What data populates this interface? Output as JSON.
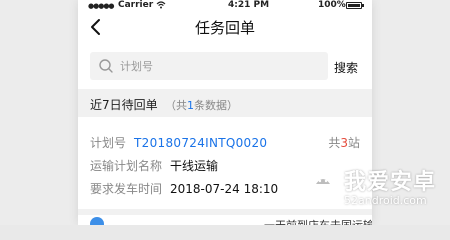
{
  "status_bar": {
    "signal": "●●●●●",
    "carrier": "Carrier",
    "time": "4:21 PM",
    "battery_pct": "100%"
  },
  "nav": {
    "title": "任务回单",
    "back_icon": "chevron-left-icon"
  },
  "search": {
    "placeholder": "计划号",
    "button_label": "搜索",
    "icon": "search-icon"
  },
  "section": {
    "title": "近7日待回单",
    "count_prefix": "（共",
    "count_value": "1",
    "count_suffix": "条数据）"
  },
  "card": {
    "plan_no_label": "计划号",
    "plan_no_value": "T20180724INTQ0020",
    "stations_prefix": "共",
    "stations_value": "3",
    "stations_suffix": "站",
    "plan_name_label": "运输计划名称",
    "plan_name_value": "干线运输",
    "depart_label": "要求发车时间",
    "depart_value": "2018-07-24 18:10"
  },
  "next_card": {
    "text": "一天前到店车去国运输"
  },
  "watermark": {
    "title": "我爱安卓",
    "url": "52android.com"
  },
  "colors": {
    "accent": "#1a73e8",
    "alert": "#e54b3c",
    "section_bg": "#f1f1f1",
    "search_bg": "#f2f2f2"
  }
}
